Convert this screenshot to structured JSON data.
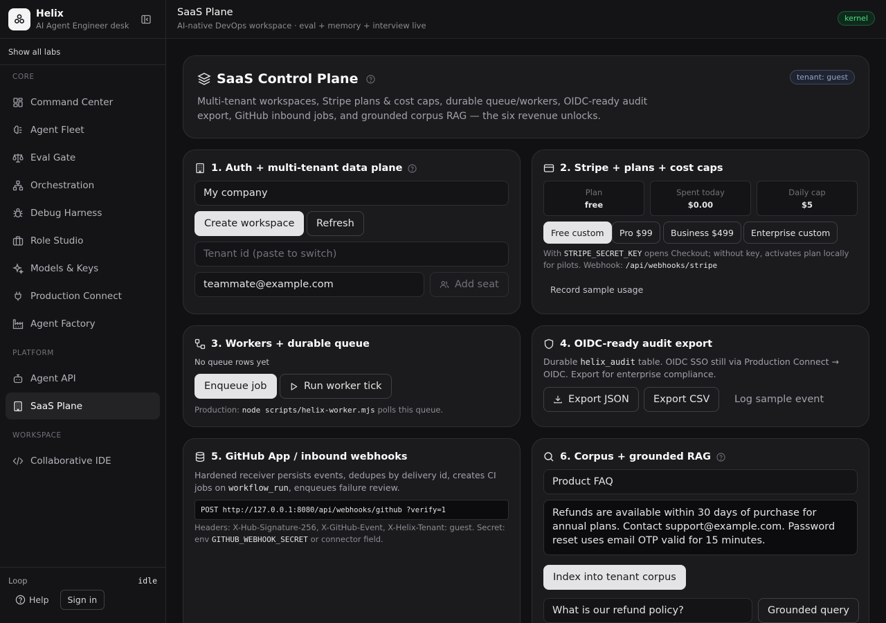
{
  "brand": {
    "name": "Helix",
    "subtitle": "AI Agent Engineer desk"
  },
  "sidebar": {
    "show_all": "Show all labs",
    "sections": {
      "core": "CORE",
      "platform": "PLATFORM",
      "workspace": "WORKSPACE"
    },
    "core_items": [
      {
        "label": "Command Center",
        "icon": "grid-icon"
      },
      {
        "label": "Agent Fleet",
        "icon": "brain-icon"
      },
      {
        "label": "Eval Gate",
        "icon": "scale-icon"
      },
      {
        "label": "Orchestration",
        "icon": "network-icon"
      },
      {
        "label": "Debug Harness",
        "icon": "bug-icon"
      },
      {
        "label": "Role Studio",
        "icon": "briefcase-icon"
      },
      {
        "label": "Models & Keys",
        "icon": "sparkles-icon"
      },
      {
        "label": "Production Connect",
        "icon": "plug-icon"
      },
      {
        "label": "Agent Factory",
        "icon": "factory-icon"
      }
    ],
    "platform_items": [
      {
        "label": "Agent API",
        "icon": "bot-icon"
      },
      {
        "label": "SaaS Plane",
        "icon": "building-icon"
      }
    ],
    "workspace_items": [
      {
        "label": "Collaborative IDE",
        "icon": "code-icon"
      }
    ],
    "footer": {
      "loop_label": "Loop",
      "loop_status": "idle",
      "help": "Help",
      "sign_in": "Sign in"
    }
  },
  "topbar": {
    "title": "SaaS Plane",
    "subtitle": "AI-native DevOps workspace · eval + memory + interview live",
    "badge": "kernel"
  },
  "hero": {
    "title": "SaaS Control Plane",
    "tenant_badge": "tenant: guest",
    "description": "Multi-tenant workspaces, Stripe plans & cost caps, durable queue/workers, OIDC-ready audit export, GitHub inbound jobs, and grounded corpus RAG — the six revenue unlocks."
  },
  "auth": {
    "title": "1. Auth + multi-tenant data plane",
    "workspace_value": "My company",
    "create_button": "Create workspace",
    "refresh_button": "Refresh",
    "tenant_placeholder": "Tenant id (paste to switch)",
    "email_value": "teammate@example.com",
    "add_seat_button": "Add seat"
  },
  "stripe": {
    "title": "2. Stripe + plans + cost caps",
    "stats": [
      {
        "label": "Plan",
        "value": "free"
      },
      {
        "label": "Spent today",
        "value": "$0.00"
      },
      {
        "label": "Daily cap",
        "value": "$5"
      }
    ],
    "plans": [
      "Free custom",
      "Pro $99",
      "Business $499",
      "Enterprise custom"
    ],
    "selected_plan": "Free custom",
    "note_with": "With",
    "note_key": "STRIPE_SECRET_KEY",
    "note_mid": "opens Checkout; without key, activates plan locally for pilots. Webhook:",
    "note_path": "/api/webhooks/stripe",
    "record_button": "Record sample usage"
  },
  "workers": {
    "title": "3. Workers + durable queue",
    "status": "No queue rows yet",
    "enqueue_button": "Enqueue job",
    "tick_button": "Run worker tick",
    "note_prefix": "Production:",
    "note_cmd": "node scripts/helix-worker.mjs",
    "note_suffix": "polls this queue."
  },
  "audit": {
    "title": "4. OIDC-ready audit export",
    "desc_prefix": "Durable",
    "desc_table": "helix_audit",
    "desc_suffix": "table. OIDC SSO still via Production Connect → OIDC. Export for enterprise compliance.",
    "export_json": "Export JSON",
    "export_csv": "Export CSV",
    "log_button": "Log sample event"
  },
  "github": {
    "title": "5. GitHub App / inbound webhooks",
    "desc_prefix": "Hardened receiver persists events, dedupes by delivery id, creates CI jobs on",
    "desc_code": "workflow_run",
    "desc_suffix": ", enqueues failure review.",
    "endpoint": "POST http://127.0.0.1:8080/api/webhooks/github ?verify=1",
    "headers_note": "Headers: X-Hub-Signature-256, X-GitHub-Event, X-Helix-Tenant: guest. Secret: env",
    "secret_name": "GITHUB_WEBHOOK_SECRET",
    "secret_suffix": "or connector field."
  },
  "rag": {
    "title": "6. Corpus + grounded RAG",
    "doc_title": "Product FAQ",
    "doc_body": "Refunds are available within 30 days of purchase for annual plans. Contact support@example.com. Password reset uses email OTP valid for 15 minutes.",
    "index_button": "Index into tenant corpus",
    "query_value": "What is our refund policy?",
    "query_button": "Grounded query"
  },
  "colors": {
    "accent_green": "#4ade80",
    "background": "#18181b",
    "card": "#1b1b1e",
    "primary_button": "#e4e4e7"
  }
}
